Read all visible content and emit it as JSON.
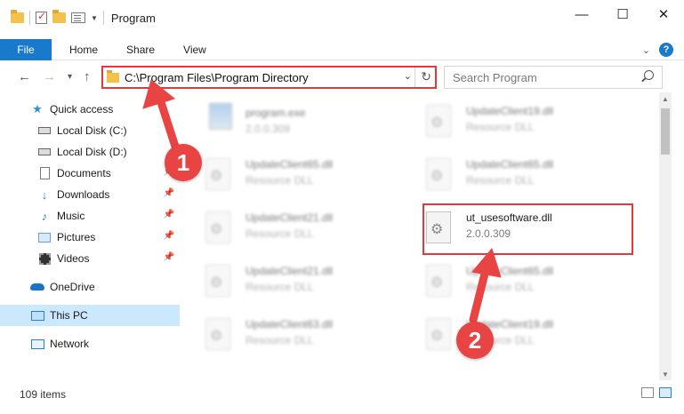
{
  "window": {
    "title": "Program",
    "controls": {
      "minimize": "—",
      "maximize": "☐",
      "close": "✕"
    }
  },
  "ribbon": {
    "tabs": [
      {
        "label": "File"
      },
      {
        "label": "Home"
      },
      {
        "label": "Share"
      },
      {
        "label": "View"
      }
    ],
    "help": "?"
  },
  "address": {
    "path": "C:\\Program Files\\Program Directory",
    "search_placeholder": "Search Program"
  },
  "sidebar": {
    "items": [
      {
        "label": "Quick access",
        "icon": "star-icon"
      },
      {
        "label": "Local Disk (C:)",
        "icon": "drive-icon"
      },
      {
        "label": "Local Disk (D:)",
        "icon": "drive-icon"
      },
      {
        "label": "Documents",
        "icon": "documents-icon",
        "pinned": true
      },
      {
        "label": "Downloads",
        "icon": "downloads-icon",
        "pinned": true
      },
      {
        "label": "Music",
        "icon": "music-icon",
        "pinned": true
      },
      {
        "label": "Pictures",
        "icon": "pictures-icon",
        "pinned": true
      },
      {
        "label": "Videos",
        "icon": "videos-icon",
        "pinned": true
      },
      {
        "label": "OneDrive",
        "icon": "onedrive-icon"
      },
      {
        "label": "This PC",
        "icon": "this-pc-icon",
        "selected": true
      },
      {
        "label": "Network",
        "icon": "network-icon"
      }
    ]
  },
  "files": [
    {
      "name": "program.exe",
      "sub": "2.0.0.309",
      "blurred": true
    },
    {
      "name": "UpdateClient19.dll",
      "sub": "Resource DLL",
      "blurred": true
    },
    {
      "name": "UpdateClient65.dll",
      "sub": "Resource DLL",
      "blurred": true
    },
    {
      "name": "UpdateClient65.dll",
      "sub": "Resource DLL",
      "blurred": true
    },
    {
      "name": "UpdateClient21.dll",
      "sub": "Resource DLL",
      "blurred": true
    },
    {
      "name": "ut_usesoftware.dll",
      "sub": "2.0.0.309",
      "blurred": false
    },
    {
      "name": "UpdateClient21.dll",
      "sub": "Resource DLL",
      "blurred": true
    },
    {
      "name": "UpdateClient65.dll",
      "sub": "Resource DLL",
      "blurred": true
    },
    {
      "name": "UpdateClient63.dll",
      "sub": "Resource DLL",
      "blurred": true
    },
    {
      "name": "UpdateClient19.dll",
      "sub": "Resource DLL",
      "blurred": true
    }
  ],
  "status": {
    "item_count": "109 items"
  },
  "annotations": {
    "step1": "1",
    "step2": "2",
    "color": "#e84444"
  }
}
